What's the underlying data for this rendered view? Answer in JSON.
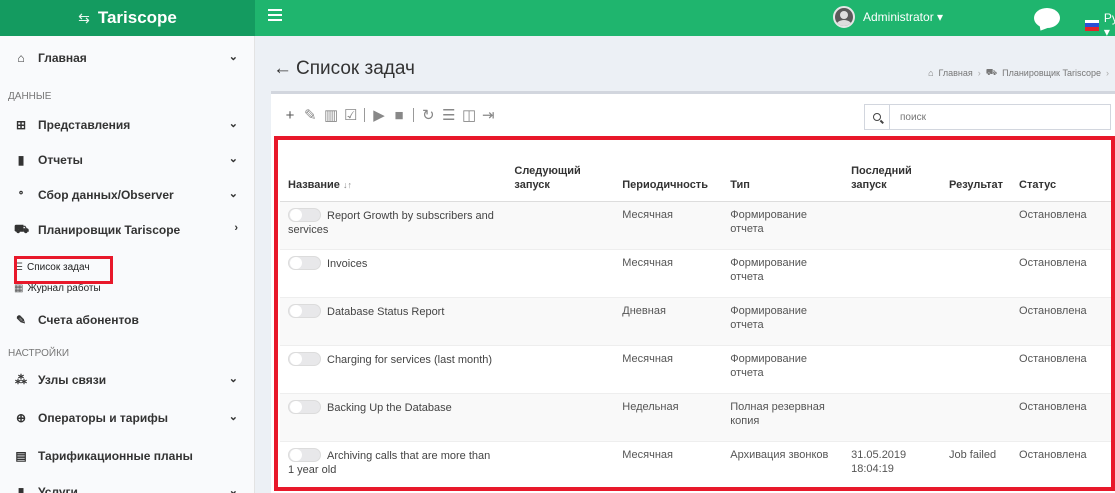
{
  "brand": {
    "name": "Tariscope",
    "icon": "tariscope-logo-icon"
  },
  "header": {
    "user_label": "Administrator ▾",
    "lang_label": "Русский ▾"
  },
  "sidebar": {
    "items": [
      {
        "label": "Главная",
        "icon": "home-icon"
      },
      {
        "label": "Представления",
        "icon": "grid-icon"
      },
      {
        "label": "Отчеты",
        "icon": "document-icon"
      },
      {
        "label": "Сбор данных/Observer",
        "icon": "antenna-icon"
      },
      {
        "label": "Планировщик Tariscope",
        "icon": "cab-icon"
      },
      {
        "label": "Счета абонентов",
        "icon": "edit-icon"
      },
      {
        "label": "Узлы связи",
        "icon": "nodes-icon"
      },
      {
        "label": "Операторы и тарифы",
        "icon": "globe-icon"
      },
      {
        "label": "Тарификационные планы",
        "icon": "list-icon"
      },
      {
        "label": "Услуги",
        "icon": "service-icon"
      }
    ],
    "section_data": "ДАННЫЕ",
    "section_settings": "НАСТРОЙКИ",
    "sub_tasks": "Список задач",
    "sub_log": "Журнал работы"
  },
  "page": {
    "title": "Список задач",
    "back_arrow": "←",
    "breadcrumb": [
      "Главная",
      "Планировщик Tariscope"
    ]
  },
  "search": {
    "placeholder": "поиск"
  },
  "table": {
    "headers": [
      "Название ↓̲↑",
      "Следующий запуск",
      "Периодичность",
      "Тип",
      "Последний запуск",
      "Результат",
      "Статус"
    ],
    "header_name": "Название",
    "header_next": "Следующий запуск",
    "header_period": "Периодичность",
    "header_type": "Тип",
    "header_last": "Последний запуск",
    "header_result": "Результат",
    "header_status": "Статус",
    "rows": [
      {
        "name": "Report Growth by subscribers and services",
        "next": "",
        "period": "Месячная",
        "type": "Формирование отчета",
        "last": "",
        "result": "",
        "status": "Остановлена"
      },
      {
        "name": "Invoices",
        "next": "",
        "period": "Месячная",
        "type": "Формирование отчета",
        "last": "",
        "result": "",
        "status": "Остановлена"
      },
      {
        "name": "Database Status Report",
        "next": "",
        "period": "Дневная",
        "type": "Формирование отчета",
        "last": "",
        "result": "",
        "status": "Остановлена"
      },
      {
        "name": "Charging for services (last month)",
        "next": "",
        "period": "Месячная",
        "type": "Формирование отчета",
        "last": "",
        "result": "",
        "status": "Остановлена"
      },
      {
        "name": "Backing Up the Database",
        "next": "",
        "period": "Недельная",
        "type": "Полная резервная копия",
        "last": "",
        "result": "",
        "status": "Остановлена"
      },
      {
        "name": "Archiving calls that are more than 1 year old",
        "next": "",
        "period": "Месячная",
        "type": "Архивация звонков",
        "last": "31.05.2019 18:04:19",
        "result": "Job failed",
        "status": "Остановлена"
      }
    ]
  },
  "colors": {
    "brand_dark": "#149b60",
    "brand": "#1fb56e",
    "highlight": "#e8182a"
  }
}
